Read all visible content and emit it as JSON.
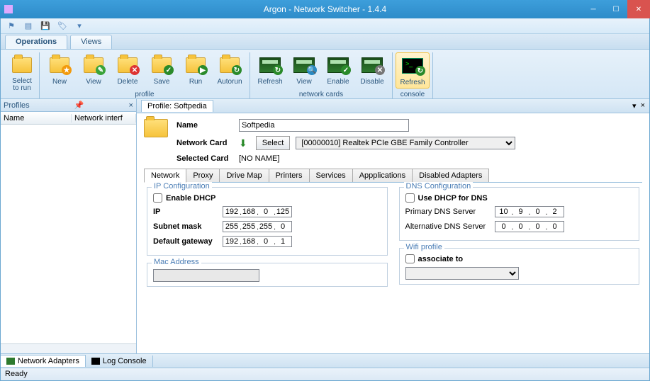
{
  "title": "Argon - Network Switcher - 1.4.4",
  "mainTabs": {
    "operations": "Operations",
    "views": "Views"
  },
  "ribbon": {
    "select": "Select\nto run",
    "new": "New",
    "view": "View",
    "delete": "Delete",
    "save": "Save",
    "run": "Run",
    "autorun": "Autorun",
    "profileGroup": "profile",
    "refreshNet": "Refresh",
    "viewNet": "View",
    "enable": "Enable",
    "disable": "Disable",
    "netGroup": "network cards",
    "refreshCon": "Refresh",
    "consoleGroup": "console"
  },
  "leftPane": {
    "title": "Profiles",
    "col1": "Name",
    "col2": "Network interf"
  },
  "profile": {
    "tab": "Profile: Softpedia",
    "nameLabel": "Name",
    "nameValue": "Softpedia",
    "netcardLabel": "Network Card",
    "selectBtn": "Select",
    "netcardValue": "[00000010] Realtek PCIe GBE Family Controller",
    "selectedLabel": "Selected Card",
    "selectedValue": "[NO NAME]"
  },
  "subtabs": {
    "network": "Network",
    "proxy": "Proxy",
    "drive": "Drive Map",
    "printers": "Printers",
    "services": "Services",
    "apps": "Appplications",
    "disabled": "Disabled Adapters"
  },
  "ipconfig": {
    "title": "IP Configuration",
    "dhcp": "Enable DHCP",
    "iplabel": "IP",
    "ip": [
      "192",
      "168",
      "0",
      "125"
    ],
    "subnetlabel": "Subnet mask",
    "subnet": [
      "255",
      "255",
      "255",
      "0"
    ],
    "gwlabel": "Default gateway",
    "gw": [
      "192",
      "168",
      "0",
      "1"
    ]
  },
  "mac": {
    "title": "Mac Address"
  },
  "dns": {
    "title": "DNS Configuration",
    "usedhcp": "Use DHCP for DNS",
    "primarylabel": "Primary DNS Server",
    "primary": [
      "10",
      "9",
      "0",
      "2"
    ],
    "altlabel": "Alternative DNS Server",
    "alt": [
      "0",
      "0",
      "0",
      "0"
    ]
  },
  "wifi": {
    "title": "Wifi profile",
    "associate": "associate to"
  },
  "footerTabs": {
    "net": "Network Adapters",
    "log": "Log Console"
  },
  "status": "Ready"
}
